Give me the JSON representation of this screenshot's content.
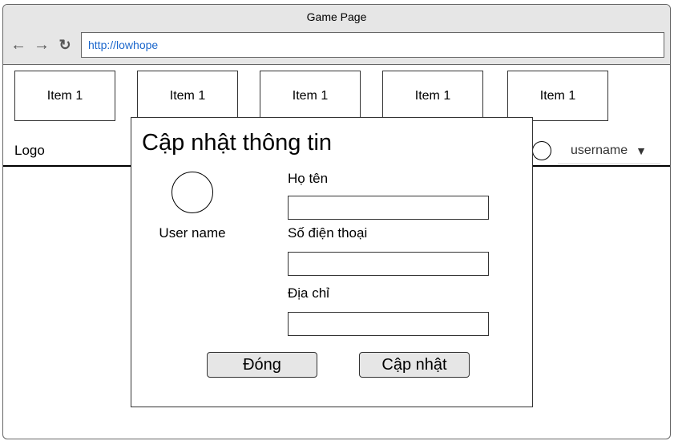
{
  "window": {
    "title": "Game Page"
  },
  "browser": {
    "url": "http://lowhope"
  },
  "nav": {
    "back_icon": "←",
    "forward_icon": "→",
    "reload_icon": "↻",
    "items": [
      {
        "label": "Item 1"
      },
      {
        "label": "Item 1"
      },
      {
        "label": "Item 1"
      },
      {
        "label": "Item 1"
      },
      {
        "label": "Item 1"
      }
    ]
  },
  "header": {
    "logo": "Logo",
    "username": "username",
    "caret_icon": "▼"
  },
  "modal": {
    "title": "Cập nhật thông tin",
    "profile_name": "User name",
    "fields": {
      "name_label": "Họ tên",
      "phone_label": "Số điện thoại",
      "address_label": "Địa chỉ"
    },
    "buttons": {
      "close_label": "Đóng",
      "update_label": "Cập nhật"
    }
  }
}
